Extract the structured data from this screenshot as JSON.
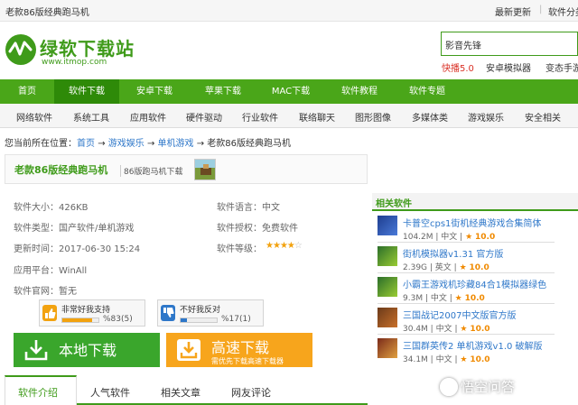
{
  "topbar": {
    "site_title": "老款86版经典跑马机",
    "latest": "最新更新",
    "divider": "|",
    "category": "软件分类"
  },
  "header": {
    "logo_text": "绿软下载站",
    "logo_url": "www.itmop.com",
    "search_value": "影音先锋",
    "hot_links": [
      {
        "label": "快播5.0",
        "color": "#d93025"
      },
      {
        "label": "安卓模拟器",
        "color": "#333333"
      },
      {
        "label": "变态手游",
        "color": "#333333"
      }
    ]
  },
  "nav": {
    "items": [
      "首页",
      "软件下载",
      "安卓下载",
      "苹果下载",
      "MAC下载",
      "软件教程",
      "软件专题"
    ],
    "active_index": 1
  },
  "subnav": {
    "items": [
      "网络软件",
      "系统工具",
      "应用软件",
      "硬件驱动",
      "行业软件",
      "联络聊天",
      "图形图像",
      "多媒体类",
      "游戏娱乐",
      "安全相关"
    ]
  },
  "breadcrumb": {
    "prefix": "您当前所在位置：",
    "home": "首页",
    "arrow": "→",
    "cat1": "游戏娱乐",
    "cat2": "单机游戏",
    "current": "老款86版经典跑马机"
  },
  "software": {
    "title": "老款86版经典跑马机",
    "tag": "86版跑马机下载",
    "size": "软件大小：426KB",
    "language": "软件语言：中文",
    "type": "软件类型：国产软件/单机游戏",
    "license": "软件授权：免费软件",
    "updated": "更新时间：2017-06-30 15:24",
    "rating_label": "软件等级：",
    "rating_stars": 4,
    "rating_max": 5,
    "platform": "应用平台：WinAll",
    "website": "软件官网：暂无"
  },
  "votes": {
    "like_label": "非常好我支持",
    "like_value": "%83(5)",
    "like_fraction": 0.83,
    "dislike_label": "不好我反对",
    "dislike_value": "%17(1)",
    "dislike_fraction": 0.17
  },
  "downloads": {
    "local_label": "本地下载",
    "fast_label": "高速下载",
    "fast_sub": "需优先下载高速下载器"
  },
  "related": {
    "title": "相关软件",
    "star": "★",
    "items": [
      {
        "name": "卡普空cps1街机经典游戏合集简体",
        "size": "104.2M",
        "lang": "中文",
        "score": "10.0"
      },
      {
        "name": "街机模拟器v1.31 官方版",
        "size": "2.39G",
        "lang": "英文",
        "score": "10.0"
      },
      {
        "name": "小霸王游戏机珍藏84合1模拟器绿色",
        "size": "9.3M",
        "lang": "中文",
        "score": "10.0"
      },
      {
        "name": "三国战记2007中文版官方版",
        "size": "30.4M",
        "lang": "中文",
        "score": "10.0"
      },
      {
        "name": "三国群英传2 单机游戏v1.0 破解版",
        "size": "34.1M",
        "lang": "中文",
        "score": "10.0"
      }
    ]
  },
  "tabs": [
    "软件介绍",
    "人气软件",
    "相关文章",
    "网友评论"
  ],
  "watermark": "悟空问答",
  "colors": {
    "brand_green": "#3f9b1a",
    "nav_green": "#4aa619",
    "download_green": "#3aa62c",
    "download_orange": "#f7a51c",
    "link_blue": "#2e77c9",
    "score_orange": "#f08a00"
  }
}
